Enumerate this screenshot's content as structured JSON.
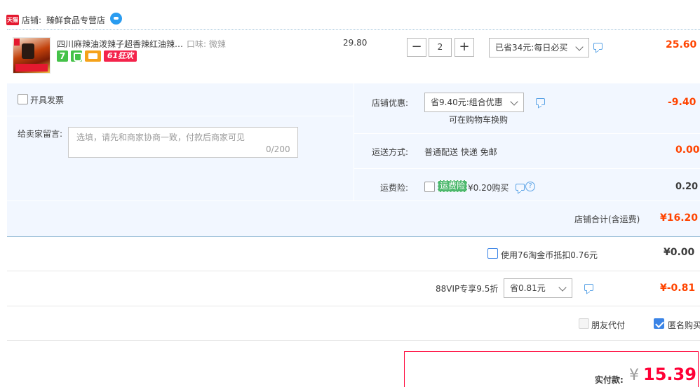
{
  "store": {
    "badge": "天猫",
    "label": "店铺:",
    "name": "臻鲜食品专营店"
  },
  "item": {
    "title": "四川麻辣油泼辣子超香辣红油辣椒酱",
    "sku": "口味: 微辣",
    "tag_seven": "7",
    "promo_tag": "61狂欢",
    "unit_price": "29.80",
    "qty_minus": "−",
    "quantity": "2",
    "qty_plus": "+",
    "discount_option": "已省34元:每日必买",
    "total": "25.60"
  },
  "invoice": {
    "label": "开具发票"
  },
  "memo": {
    "label": "给卖家留言:",
    "placeholder": "选填，请先和商家协商一致，付款后商家可见",
    "count": "0/200"
  },
  "store_discount": {
    "label": "店铺优惠:",
    "option": "省9.40元:组合优惠",
    "sub_note": "可在购物车换购",
    "value": "-9.40"
  },
  "shipping": {
    "label": "运送方式:",
    "method": "普通配送 快递 免邮",
    "value": "0.00"
  },
  "insurance": {
    "label": "运费险:",
    "tag": "运费险",
    "price_text": "¥0.20购买",
    "help": "?",
    "value": "0.20"
  },
  "store_total": {
    "label": "店铺合计(含运费)",
    "value": "¥16.20"
  },
  "coins": {
    "label": "使用76淘金币抵扣0.76元",
    "value": "¥0.00"
  },
  "vip": {
    "label": "88VIP专享9.5折",
    "option": "省0.81元",
    "value": "¥-0.81"
  },
  "options": {
    "friend_pay": "朋友代付",
    "anonymous": "匿名购买"
  },
  "payment": {
    "label": "实付款:",
    "currency": "¥",
    "value": "15.39"
  },
  "colors": {
    "price_red": "#ff4400",
    "pay_red": "#ff0036",
    "panel_bg": "#f2f7ff",
    "tmall_red": "#e4192f",
    "checkbox_blue": "#3b84e6"
  }
}
